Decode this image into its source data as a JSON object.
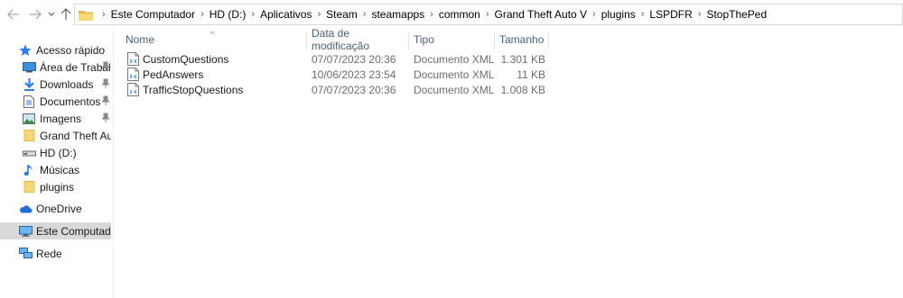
{
  "address_bar": {
    "breadcrumbs": [
      "Este Computador",
      "HD (D:)",
      "Aplicativos",
      "Steam",
      "steamapps",
      "common",
      "Grand Theft Auto V",
      "plugins",
      "LSPDFR",
      "StopThePed"
    ],
    "separator": "›"
  },
  "nav_buttons": {
    "back_icon": "arrow-left-icon",
    "forward_icon": "arrow-right-icon",
    "recent_icon": "chevron-down-icon",
    "up_icon": "arrow-up-icon"
  },
  "sidebar": {
    "items": [
      {
        "label": "Acesso rápido",
        "icon": "star-icon",
        "pinned": false
      },
      {
        "label": "Área de Trabalho",
        "icon": "desktop-icon",
        "pinned": true
      },
      {
        "label": "Downloads",
        "icon": "download-icon",
        "pinned": true
      },
      {
        "label": "Documentos",
        "icon": "document-icon",
        "pinned": true
      },
      {
        "label": "Imagens",
        "icon": "image-icon",
        "pinned": true
      },
      {
        "label": "Grand Theft Auto V",
        "icon": "folder-icon",
        "pinned": false
      },
      {
        "label": "HD (D:)",
        "icon": "drive-icon",
        "pinned": false
      },
      {
        "label": "Músicas",
        "icon": "music-icon",
        "pinned": false
      },
      {
        "label": "plugins",
        "icon": "folder-icon",
        "pinned": false
      },
      {
        "label": "OneDrive",
        "icon": "cloud-icon",
        "pinned": false
      },
      {
        "label": "Este Computador",
        "icon": "computer-icon",
        "pinned": false,
        "selected": true
      },
      {
        "label": "Rede",
        "icon": "network-icon",
        "pinned": false
      }
    ]
  },
  "columns": {
    "name": "Nome",
    "date": "Data de modificação",
    "type": "Tipo",
    "size": "Tamanho",
    "sort_indicator": "^"
  },
  "files": [
    {
      "name": "CustomQuestions",
      "date": "07/07/2023 20:36",
      "type": "Documento XML",
      "size": "1.301 KB"
    },
    {
      "name": "PedAnswers",
      "date": "10/06/2023 23:54",
      "type": "Documento XML",
      "size": "11 KB"
    },
    {
      "name": "TrafficStopQuestions",
      "date": "07/07/2023 20:36",
      "type": "Documento XML",
      "size": "1.008 KB"
    }
  ],
  "colors": {
    "header_text": "#4c607a",
    "selected_bg": "#d9d9d9",
    "folder_yellow": "#f8d775"
  }
}
